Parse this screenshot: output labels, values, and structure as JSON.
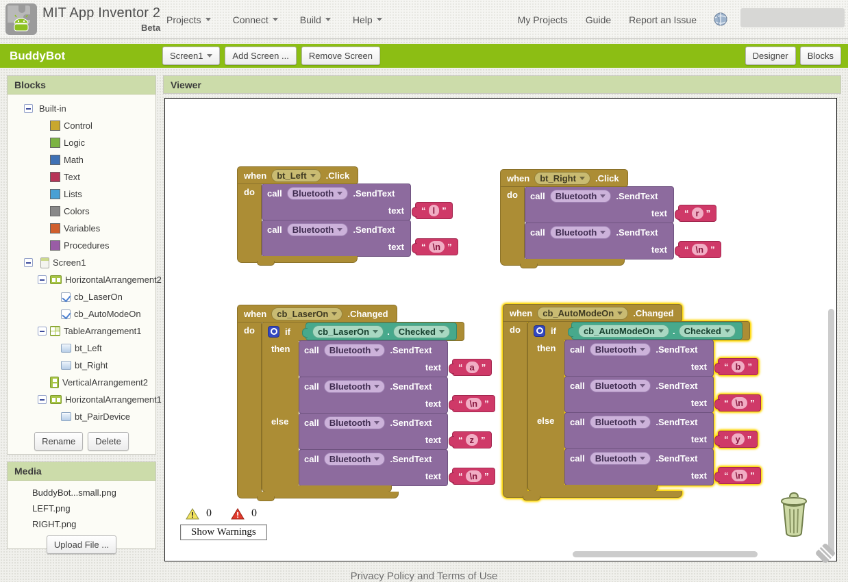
{
  "header": {
    "title": "MIT App Inventor 2",
    "subtitle": "Beta",
    "menus": [
      {
        "label": "Projects"
      },
      {
        "label": "Connect"
      },
      {
        "label": "Build"
      },
      {
        "label": "Help"
      }
    ],
    "links": [
      {
        "label": "My Projects"
      },
      {
        "label": "Guide"
      },
      {
        "label": "Report an Issue"
      }
    ]
  },
  "toolbar": {
    "project_name": "BuddyBot",
    "screen_button": "Screen1",
    "add_screen_button": "Add Screen ...",
    "remove_screen_button": "Remove Screen",
    "designer_button": "Designer",
    "blocks_button": "Blocks"
  },
  "palette": {
    "title": "Blocks",
    "builtin_label": "Built-in",
    "builtin": [
      {
        "label": "Control",
        "color": "#c8a72e"
      },
      {
        "label": "Logic",
        "color": "#7cb342"
      },
      {
        "label": "Math",
        "color": "#3f71b5"
      },
      {
        "label": "Text",
        "color": "#b73558"
      },
      {
        "label": "Lists",
        "color": "#49a0d4"
      },
      {
        "label": "Colors",
        "color": "#888888"
      },
      {
        "label": "Variables",
        "color": "#d05f2d"
      },
      {
        "label": "Procedures",
        "color": "#9a5ca6"
      }
    ],
    "screen_label": "Screen1",
    "components": [
      {
        "label": "HorizontalArrangement2"
      },
      {
        "label": "cb_LaserOn"
      },
      {
        "label": "cb_AutoModeOn"
      },
      {
        "label": "TableArrangement1"
      },
      {
        "label": "bt_Left"
      },
      {
        "label": "bt_Right"
      },
      {
        "label": "VerticalArrangement2"
      },
      {
        "label": "HorizontalArrangement1"
      },
      {
        "label": "bt_PairDevice"
      }
    ],
    "rename_button": "Rename",
    "delete_button": "Delete"
  },
  "media": {
    "title": "Media",
    "files": [
      {
        "name": "BuddyBot...small.png"
      },
      {
        "name": "LEFT.png"
      },
      {
        "name": "RIGHT.png"
      }
    ],
    "upload_button": "Upload File ..."
  },
  "viewer": {
    "title": "Viewer",
    "warning_count": "0",
    "error_count": "0",
    "show_warnings_button": "Show Warnings"
  },
  "blocks": {
    "labels": {
      "when": "when",
      "do": "do",
      "call": "call",
      "if": "if",
      "then": "then",
      "else": "else",
      "dot": ".",
      "text_param": "text",
      "open_quote": "“",
      "close_quote": "”"
    },
    "bt_left_click": {
      "component": "bt_Left",
      "event": ".Click",
      "calls": [
        {
          "component": "Bluetooth",
          "method": ".SendText",
          "value": "l"
        },
        {
          "component": "Bluetooth",
          "method": ".SendText",
          "value": "\\n"
        }
      ]
    },
    "bt_right_click": {
      "component": "bt_Right",
      "event": ".Click",
      "calls": [
        {
          "component": "Bluetooth",
          "method": ".SendText",
          "value": "r"
        },
        {
          "component": "Bluetooth",
          "method": ".SendText",
          "value": "\\n"
        }
      ]
    },
    "cb_laser_changed": {
      "component": "cb_LaserOn",
      "event": ".Changed",
      "condition": {
        "component": "cb_LaserOn",
        "property": "Checked"
      },
      "then_calls": [
        {
          "component": "Bluetooth",
          "method": ".SendText",
          "value": "a"
        },
        {
          "component": "Bluetooth",
          "method": ".SendText",
          "value": "\\n"
        }
      ],
      "else_calls": [
        {
          "component": "Bluetooth",
          "method": ".SendText",
          "value": "z"
        },
        {
          "component": "Bluetooth",
          "method": ".SendText",
          "value": "\\n"
        }
      ]
    },
    "cb_automode_changed": {
      "component": "cb_AutoModeOn",
      "event": ".Changed",
      "selected": true,
      "condition": {
        "component": "cb_AutoModeOn",
        "property": "Checked"
      },
      "then_calls": [
        {
          "component": "Bluetooth",
          "method": ".SendText",
          "value": "b"
        },
        {
          "component": "Bluetooth",
          "method": ".SendText",
          "value": "\\n"
        }
      ],
      "else_calls": [
        {
          "component": "Bluetooth",
          "method": ".SendText",
          "value": "y"
        },
        {
          "component": "Bluetooth",
          "method": ".SendText",
          "value": "\\n"
        }
      ]
    }
  },
  "footer": {
    "link": "Privacy Policy and Terms of Use"
  },
  "colors": {
    "brand_green": "#8cbe14",
    "panel_header_sage": "#ccdcaa",
    "block_gold": "#ac8d35",
    "block_purple": "#8d6b9e",
    "block_pink": "#cf3968",
    "block_teal": "#47a98c",
    "selection_yellow": "#ffd800"
  }
}
